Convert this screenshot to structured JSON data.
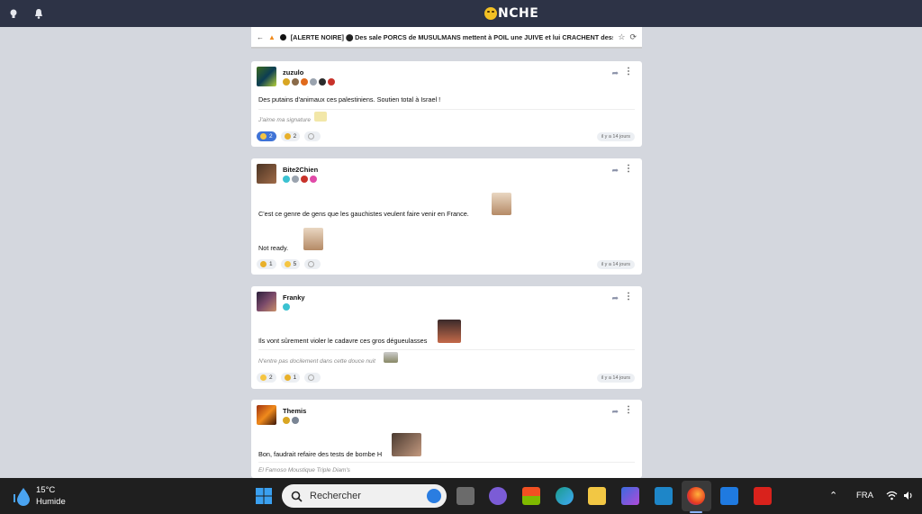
{
  "site": {
    "logo_text": "NCHE"
  },
  "topic": {
    "back_glyph": "←",
    "title": "[ALERTE NOIRE] ⬤ Des sale PORCS de MUSULMANS mettent à POIL une JUIVE et lui CRACHENT dess",
    "star_glyph": "☆",
    "refresh_glyph": "⟳"
  },
  "posts": [
    {
      "username": "zuzulo",
      "text": "Des putains d'animaux ces palestiniens. Soutien total à Israel !",
      "signature": "J'aime ma signature",
      "reactions": [
        {
          "count": "2"
        },
        {
          "count": "2"
        },
        {
          "count": ""
        }
      ],
      "time": "il y a 14 jours"
    },
    {
      "username": "Bite2Chien",
      "text": "C'est ce genre de gens que les gauchistes veulent faire venir en France.",
      "text2": "Not ready.",
      "reactions": [
        {
          "count": "1"
        },
        {
          "count": "5"
        },
        {
          "count": ""
        }
      ],
      "time": "il y a 14 jours"
    },
    {
      "username": "Franky",
      "text": "Ils vont sûrement violer le cadavre ces gros dégueulasses",
      "signature": "N'entre pas docilement dans cette douce nuit",
      "reactions": [
        {
          "count": "2"
        },
        {
          "count": "1"
        },
        {
          "count": ""
        }
      ],
      "time": "il y a 14 jours"
    },
    {
      "username": "Themis",
      "text": "Bon, faudrait refaire des tests de bombe H",
      "signature": "El Famoso Moustique Triple Diam's"
    }
  ],
  "taskbar": {
    "weather_temp": "15°C",
    "weather_desc": "Humide",
    "search_placeholder": "Rechercher",
    "lang": "FRA"
  },
  "colors": {
    "header_bg": "#2d3346",
    "page_bg": "#d4d7de",
    "accent": "#3f73d6",
    "taskbar_bg": "#1f1f1f"
  }
}
